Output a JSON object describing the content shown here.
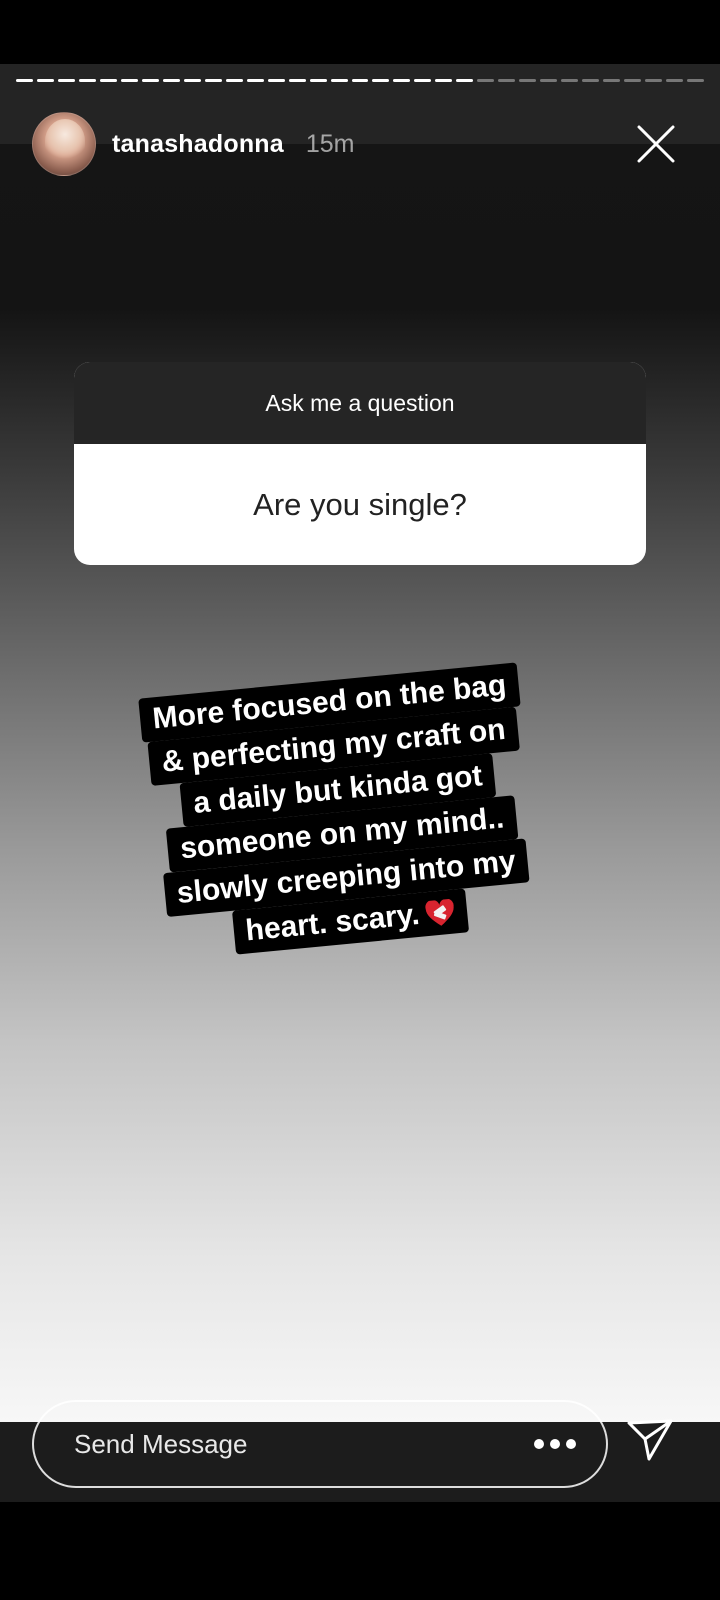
{
  "progress": {
    "segment_count": 33,
    "completed_segments": 22
  },
  "header": {
    "username": "tanashadonna",
    "time_ago": "15m",
    "avatar_icon": "profile-photo",
    "close_icon": "close-icon"
  },
  "question_sticker": {
    "prompt": "Ask me a question",
    "question": "Are you single?"
  },
  "answer": {
    "lines": [
      "More focused on the bag",
      "& perfecting my craft on",
      "a daily but kinda got",
      "someone on my mind..",
      "slowly creeping into my",
      "heart. scary."
    ],
    "emoji": "mending-heart"
  },
  "footer": {
    "message_placeholder": "Send Message",
    "more_icon": "more-dots-icon",
    "send_icon": "paper-plane-icon"
  },
  "colors": {
    "background_top": "#141414",
    "background_bottom": "#f7f7f7",
    "text_box": "#000000",
    "card_header": "#252525"
  }
}
